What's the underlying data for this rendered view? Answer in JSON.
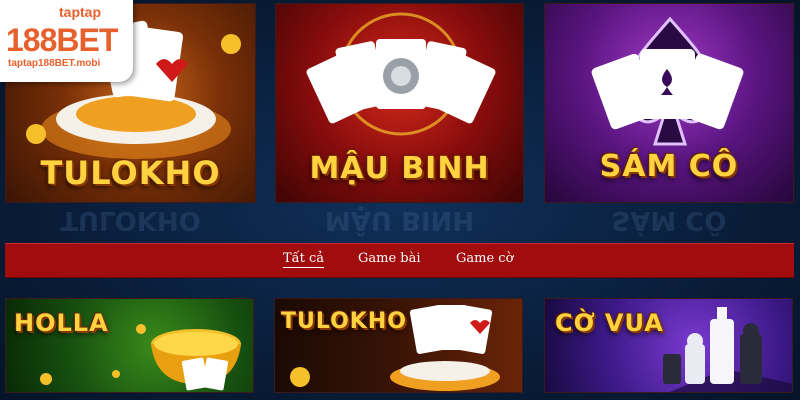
{
  "logo": {
    "top": "taptap",
    "main": "188BET",
    "url": "taptap188BET.mobi"
  },
  "games_top": [
    {
      "title": "TULOKHO"
    },
    {
      "title": "MẬU BINH"
    },
    {
      "title": "SÁM CÔ"
    }
  ],
  "filter_tabs": [
    {
      "label": "Tất cả",
      "active": true
    },
    {
      "label": "Game bài",
      "active": false
    },
    {
      "label": "Game cờ",
      "active": false
    }
  ],
  "games_bottom": [
    {
      "title": "HOLLA"
    },
    {
      "title": "TULOKHO"
    },
    {
      "title": "CỜ VUA"
    }
  ],
  "colors": {
    "filter_bar": "#a10d0d",
    "title_gold": "#ffd23f",
    "logo_orange": "#e8612c"
  }
}
